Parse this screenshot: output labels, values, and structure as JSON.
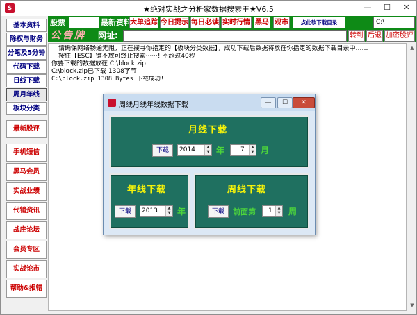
{
  "window": {
    "title": "★绝对实战之分析家数据搜索王★V6.5",
    "app_icon": "$",
    "controls": {
      "minimize": "—",
      "maximize": "☐",
      "close": "✕"
    }
  },
  "sidebar": {
    "items": [
      {
        "label": "基本资料"
      },
      {
        "label": "除权与财务"
      },
      {
        "label": "分笔及5分钟"
      },
      {
        "label": "代码下载"
      },
      {
        "label": "日线下载"
      },
      {
        "label": "周月年线"
      },
      {
        "label": "板块分类"
      },
      {
        "label": "最新股评"
      },
      {
        "label": "手机短信"
      },
      {
        "label": "黑马会员"
      },
      {
        "label": "实战业绩"
      },
      {
        "label": "代销资讯"
      },
      {
        "label": "战庄论坛"
      },
      {
        "label": "会员专区"
      },
      {
        "label": "实战论市"
      },
      {
        "label": "帮助&报错"
      }
    ]
  },
  "toolbar": {
    "stock_label": "股票",
    "news_label": "最新资料",
    "buttons": [
      {
        "label": "大单追踪"
      },
      {
        "label": "今日提示"
      },
      {
        "label": "每日必读"
      },
      {
        "label": "实时行情"
      },
      {
        "label": "黑马"
      },
      {
        "label": "观市"
      },
      {
        "label": "点此软下载目录"
      }
    ],
    "path": "C:\\"
  },
  "toolbar2": {
    "notice": "公告牌",
    "url_label": "网址:",
    "go_label": "转到",
    "back_label": "后退",
    "add_label": "加密股评"
  },
  "log": {
    "lines": [
      "请确保网络畅通无阻，正在搜寻你指定的【板块分类数据】，成功下载后数据将放在你指定的数据下载目录中……",
      "按住【ESC】键不放可终止搜索······! 不超过40秒",
      "你要下载的数据放在  C:\\block.zip",
      "C:\\block.zip已下载     1308字节",
      "C:\\block.zip     1308 Bytes 下载成功!"
    ]
  },
  "dialog": {
    "title": "周线月线年线数据下载",
    "monthly": {
      "title": "月线下载",
      "download_label": "下载",
      "year_value": "2014",
      "year_unit": "年",
      "month_value": "7",
      "month_unit": "月"
    },
    "yearly": {
      "title": "年线下载",
      "download_label": "下载",
      "year_value": "2013",
      "year_unit": "年"
    },
    "weekly": {
      "title": "周线下载",
      "download_label": "下载",
      "prefix": "前面第",
      "week_value": "1",
      "week_unit": "周"
    },
    "controls": {
      "minimize": "—",
      "maximize": "☐",
      "close": "✕"
    }
  },
  "colors": {
    "toolbar_green": "#0e8a16",
    "panel_teal": "#1f7060",
    "panel_title_yellow": "#f5f20a",
    "unit_green": "#4cd43c",
    "accent_red": "#cc0000"
  }
}
